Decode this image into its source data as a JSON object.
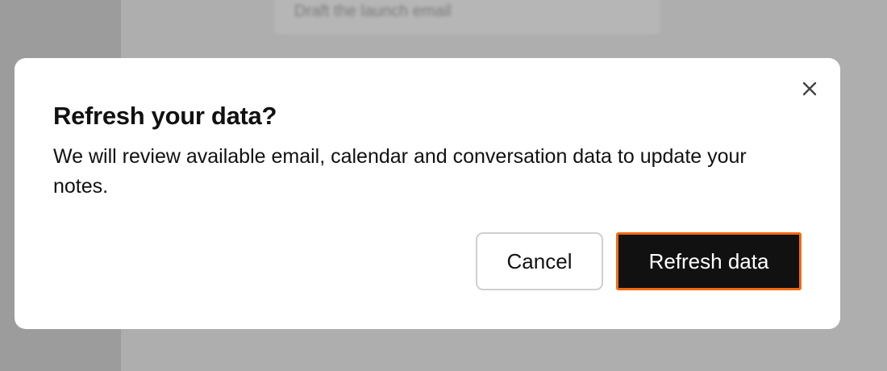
{
  "background": {
    "card_text": "Draft the launch email"
  },
  "modal": {
    "title": "Refresh your data?",
    "description": "We will review available email, calendar and conversation data to update your notes.",
    "close_icon": "close-icon",
    "cancel_label": "Cancel",
    "confirm_label": "Refresh data"
  },
  "colors": {
    "overlay": "#a3a3a3",
    "primary_button": "#111111",
    "focus_ring": "#f26b0f",
    "text": "#111111"
  }
}
